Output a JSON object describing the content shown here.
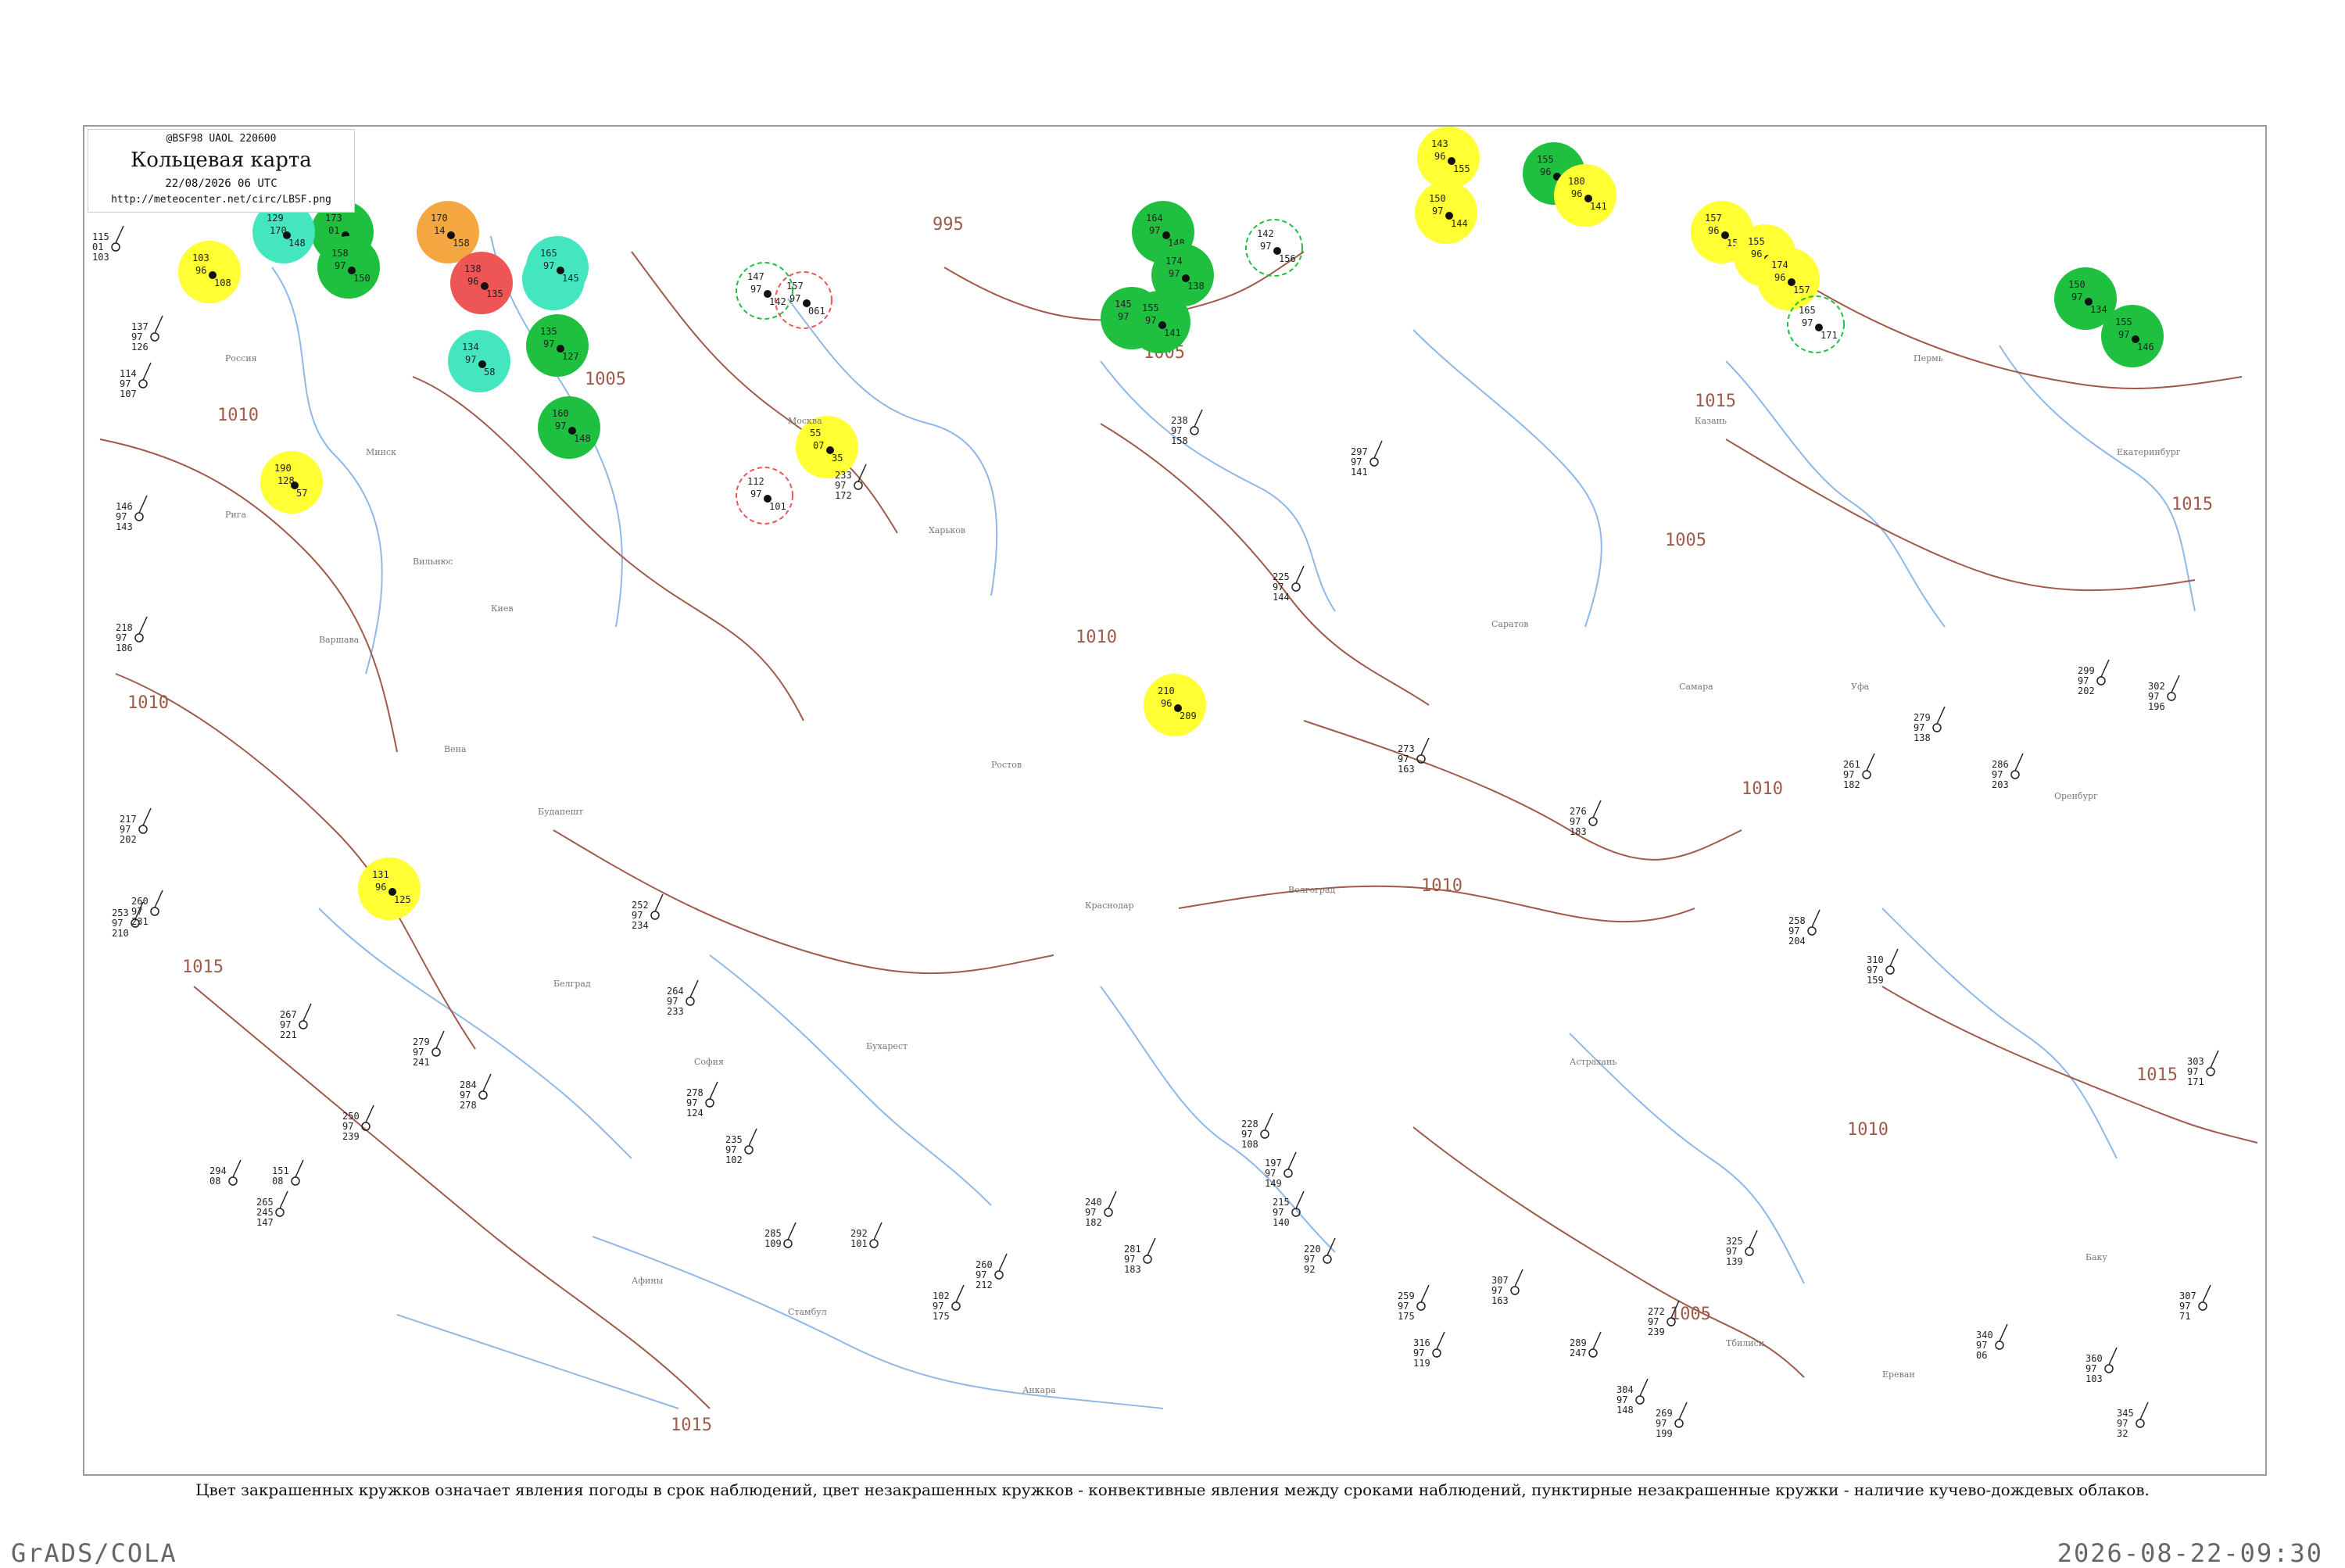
{
  "header": {
    "code_line": "@BSF98  UAOL  220600",
    "title": "Кольцевая карта",
    "date_line": "22/08/2026 06 UTC",
    "url": "http://meteocenter.net/circ/LBSF.png"
  },
  "footer": {
    "legend_note": "Цвет закрашенных кружков означает явления погоды в срок наблюдений, цвет незакрашенных кружков - конвективные явления между сроками наблюдений, пунктирные незакрашенные кружки - наличие кучево-дождевых облаков.",
    "software": "GrADS/COLA",
    "timestamp": "2026-08-22-09:30"
  },
  "colors": {
    "isobar": "#a05a4a",
    "rivers": "#8fb8e8",
    "thunderstorm": "#1fbf3f",
    "showers": "#ffff33",
    "rain": "#44e6c0",
    "fog": "#f4a640",
    "hail": "#ee5555"
  },
  "isobars": [
    {
      "label": "1010"
    },
    {
      "label": "1015"
    },
    {
      "label": "1010"
    },
    {
      "label": "1005"
    },
    {
      "label": "995"
    },
    {
      "label": "1005"
    },
    {
      "label": "1010"
    },
    {
      "label": "1010"
    },
    {
      "label": "1010"
    },
    {
      "label": "1015"
    },
    {
      "label": "1015"
    },
    {
      "label": "1005"
    },
    {
      "label": "1015"
    },
    {
      "label": "1015"
    },
    {
      "label": "1005"
    },
    {
      "label": "1010"
    }
  ],
  "weather_markers": [
    {
      "type": "thunderstorm",
      "filled": true,
      "values": [
        "173",
        "01",
        "160"
      ]
    },
    {
      "type": "thunderstorm",
      "filled": true,
      "values": [
        "158",
        "97",
        "150"
      ]
    },
    {
      "type": "rain",
      "filled": true,
      "values": [
        "129",
        "170",
        "148"
      ]
    },
    {
      "type": "fog",
      "filled": true,
      "values": [
        "170",
        "14",
        "158"
      ]
    },
    {
      "type": "hail",
      "filled": true,
      "values": [
        "138",
        "96",
        "135"
      ]
    },
    {
      "type": "rain",
      "filled": true,
      "values": [
        "173",
        "97",
        "155"
      ]
    },
    {
      "type": "thunderstorm",
      "filled": true,
      "values": [
        "135",
        "97",
        "127"
      ]
    },
    {
      "type": "thunderstorm",
      "filled": true,
      "values": [
        "160",
        "97",
        "148"
      ]
    },
    {
      "type": "showers",
      "filled": true,
      "values": [
        "103",
        "96",
        "108"
      ]
    },
    {
      "type": "showers",
      "filled": true,
      "values": [
        "190",
        "128",
        "57"
      ]
    },
    {
      "type": "showers",
      "filled": true,
      "values": [
        "55",
        "07",
        "35"
      ]
    },
    {
      "type": "thunderstorm",
      "filled": true,
      "values": [
        "164",
        "97",
        "148"
      ]
    },
    {
      "type": "thunderstorm",
      "filled": true,
      "values": [
        "174",
        "97",
        "138"
      ]
    },
    {
      "type": "thunderstorm",
      "filled": true,
      "values": [
        "145",
        "97",
        "156"
      ]
    },
    {
      "type": "thunderstorm",
      "filled": true,
      "values": [
        "155",
        "97",
        "141"
      ]
    },
    {
      "type": "showers",
      "filled": true,
      "values": [
        "143",
        "96",
        "155"
      ]
    },
    {
      "type": "showers",
      "filled": true,
      "values": [
        "150",
        "97",
        "144"
      ]
    },
    {
      "type": "thunderstorm",
      "filled": true,
      "values": [
        "155",
        "96",
        "154"
      ]
    },
    {
      "type": "showers",
      "filled": true,
      "values": [
        "180",
        "96",
        "141"
      ]
    },
    {
      "type": "showers",
      "filled": true,
      "values": [
        "157",
        "96",
        "154"
      ]
    },
    {
      "type": "showers",
      "filled": true,
      "values": [
        "155",
        "96",
        "152"
      ]
    },
    {
      "type": "showers",
      "filled": true,
      "values": [
        "174",
        "96",
        "157"
      ]
    },
    {
      "type": "thunderstorm",
      "filled": true,
      "values": [
        "150",
        "97",
        "134"
      ]
    },
    {
      "type": "thunderstorm",
      "filled": true,
      "values": [
        "155",
        "97",
        "146"
      ]
    },
    {
      "type": "showers",
      "filled": true,
      "values": [
        "210",
        "96",
        "209"
      ]
    },
    {
      "type": "showers",
      "filled": true,
      "values": [
        "131",
        "96",
        "125"
      ]
    },
    {
      "type": "rain",
      "filled": true,
      "values": [
        "134",
        "97",
        "58"
      ]
    },
    {
      "type": "rain",
      "filled": true,
      "values": [
        "165",
        "97",
        "145"
      ]
    },
    {
      "type": "thunderstorm",
      "filled": false,
      "values": [
        "147",
        "97",
        "142"
      ]
    },
    {
      "type": "thunderstorm",
      "filled": false,
      "values": [
        "165",
        "97",
        "171"
      ]
    },
    {
      "type": "thunderstorm",
      "filled": false,
      "values": [
        "142",
        "97",
        "156"
      ]
    },
    {
      "type": "hail",
      "filled": false,
      "values": [
        "157",
        "97",
        "061"
      ]
    },
    {
      "type": "hail",
      "filled": false,
      "values": [
        "112",
        "97",
        "101"
      ]
    }
  ],
  "stations": [
    {
      "values": [
        "115",
        "01",
        "103"
      ],
      "name": ""
    },
    {
      "values": [
        "137",
        "97",
        "126"
      ],
      "name": ""
    },
    {
      "values": [
        "114",
        "97",
        "107"
      ],
      "name": ""
    },
    {
      "values": [
        "146",
        "97",
        "143"
      ],
      "name": ""
    },
    {
      "values": [
        "218",
        "97",
        "186"
      ],
      "name": ""
    },
    {
      "values": [
        "217",
        "97",
        "202"
      ],
      "name": ""
    },
    {
      "values": [
        "253",
        "97",
        "210"
      ],
      "name": ""
    },
    {
      "values": [
        "260",
        "97",
        "231"
      ],
      "name": ""
    },
    {
      "values": [
        "267",
        "97",
        "221"
      ],
      "name": ""
    },
    {
      "values": [
        "279",
        "97",
        "241"
      ],
      "name": ""
    },
    {
      "values": [
        "294",
        "08",
        ""
      ],
      "name": ""
    },
    {
      "values": [
        "151",
        "08",
        ""
      ],
      "name": ""
    },
    {
      "values": [
        "265",
        "245",
        "147"
      ],
      "name": ""
    },
    {
      "values": [
        "250",
        "97",
        "239"
      ],
      "name": ""
    },
    {
      "values": [
        "284",
        "97",
        "278"
      ],
      "name": ""
    },
    {
      "values": [
        "252",
        "97",
        "234"
      ],
      "name": ""
    },
    {
      "values": [
        "264",
        "97",
        "233"
      ],
      "name": ""
    },
    {
      "values": [
        "278",
        "97",
        "124"
      ],
      "name": ""
    },
    {
      "values": [
        "235",
        "97",
        "102"
      ],
      "name": ""
    },
    {
      "values": [
        "285",
        "109",
        ""
      ],
      "name": ""
    },
    {
      "values": [
        "292",
        "101",
        ""
      ],
      "name": ""
    },
    {
      "values": [
        "102",
        "97",
        "175"
      ],
      "name": ""
    },
    {
      "values": [
        "260",
        "97",
        "212"
      ],
      "name": ""
    },
    {
      "values": [
        "240",
        "97",
        "182"
      ],
      "name": ""
    },
    {
      "values": [
        "281",
        "97",
        "183"
      ],
      "name": ""
    },
    {
      "values": [
        "228",
        "97",
        "108"
      ],
      "name": ""
    },
    {
      "values": [
        "197",
        "97",
        "149"
      ],
      "name": ""
    },
    {
      "values": [
        "215",
        "97",
        "140"
      ],
      "name": ""
    },
    {
      "values": [
        "220",
        "97",
        "92"
      ],
      "name": ""
    },
    {
      "values": [
        "259",
        "97",
        "175"
      ],
      "name": ""
    },
    {
      "values": [
        "316",
        "97",
        "119"
      ],
      "name": ""
    },
    {
      "values": [
        "307",
        "97",
        "163"
      ],
      "name": ""
    },
    {
      "values": [
        "289",
        "247",
        ""
      ],
      "name": ""
    },
    {
      "values": [
        "304",
        "97",
        "148"
      ],
      "name": ""
    },
    {
      "values": [
        "272",
        "97",
        "239"
      ],
      "name": ""
    },
    {
      "values": [
        "269",
        "97",
        "199"
      ],
      "name": ""
    },
    {
      "values": [
        "325",
        "97",
        "139"
      ],
      "name": ""
    },
    {
      "values": [
        "340",
        "97",
        "06"
      ],
      "name": ""
    },
    {
      "values": [
        "360",
        "97",
        "103"
      ],
      "name": ""
    },
    {
      "values": [
        "345",
        "97",
        "32"
      ],
      "name": ""
    },
    {
      "values": [
        "303",
        "97",
        "171"
      ],
      "name": ""
    },
    {
      "values": [
        "233",
        "97",
        "172"
      ],
      "name": ""
    },
    {
      "values": [
        "238",
        "97",
        "158"
      ],
      "name": ""
    },
    {
      "values": [
        "297",
        "97",
        "141"
      ],
      "name": ""
    },
    {
      "values": [
        "225",
        "97",
        "144"
      ],
      "name": ""
    },
    {
      "values": [
        "273",
        "97",
        "163"
      ],
      "name": ""
    },
    {
      "values": [
        "276",
        "97",
        "183"
      ],
      "name": ""
    },
    {
      "values": [
        "261",
        "97",
        "182"
      ],
      "name": ""
    },
    {
      "values": [
        "258",
        "97",
        "204"
      ],
      "name": ""
    },
    {
      "values": [
        "310",
        "97",
        "159"
      ],
      "name": ""
    },
    {
      "values": [
        "279",
        "97",
        "138"
      ],
      "name": ""
    },
    {
      "values": [
        "286",
        "97",
        "203"
      ],
      "name": ""
    },
    {
      "values": [
        "299",
        "97",
        "202"
      ],
      "name": ""
    },
    {
      "values": [
        "302",
        "97",
        "196"
      ],
      "name": ""
    },
    {
      "values": [
        "307",
        "97",
        "71"
      ],
      "name": ""
    }
  ],
  "place_names": [
    "Россия",
    "Минск",
    "Киев",
    "Москва",
    "Харьков",
    "Ростов",
    "Краснодар",
    "Волгоград",
    "Саратов",
    "Самара",
    "Уфа",
    "Казань",
    "Пермь",
    "Екатеринбург",
    "Оренбург",
    "Астрахань",
    "Тбилиси",
    "Ереван",
    "Баку",
    "Анкара",
    "Стамбул",
    "Афины",
    "София",
    "Бухарест",
    "Белград",
    "Будапешт",
    "Вена",
    "Варшава",
    "Вильнюс",
    "Рига"
  ]
}
